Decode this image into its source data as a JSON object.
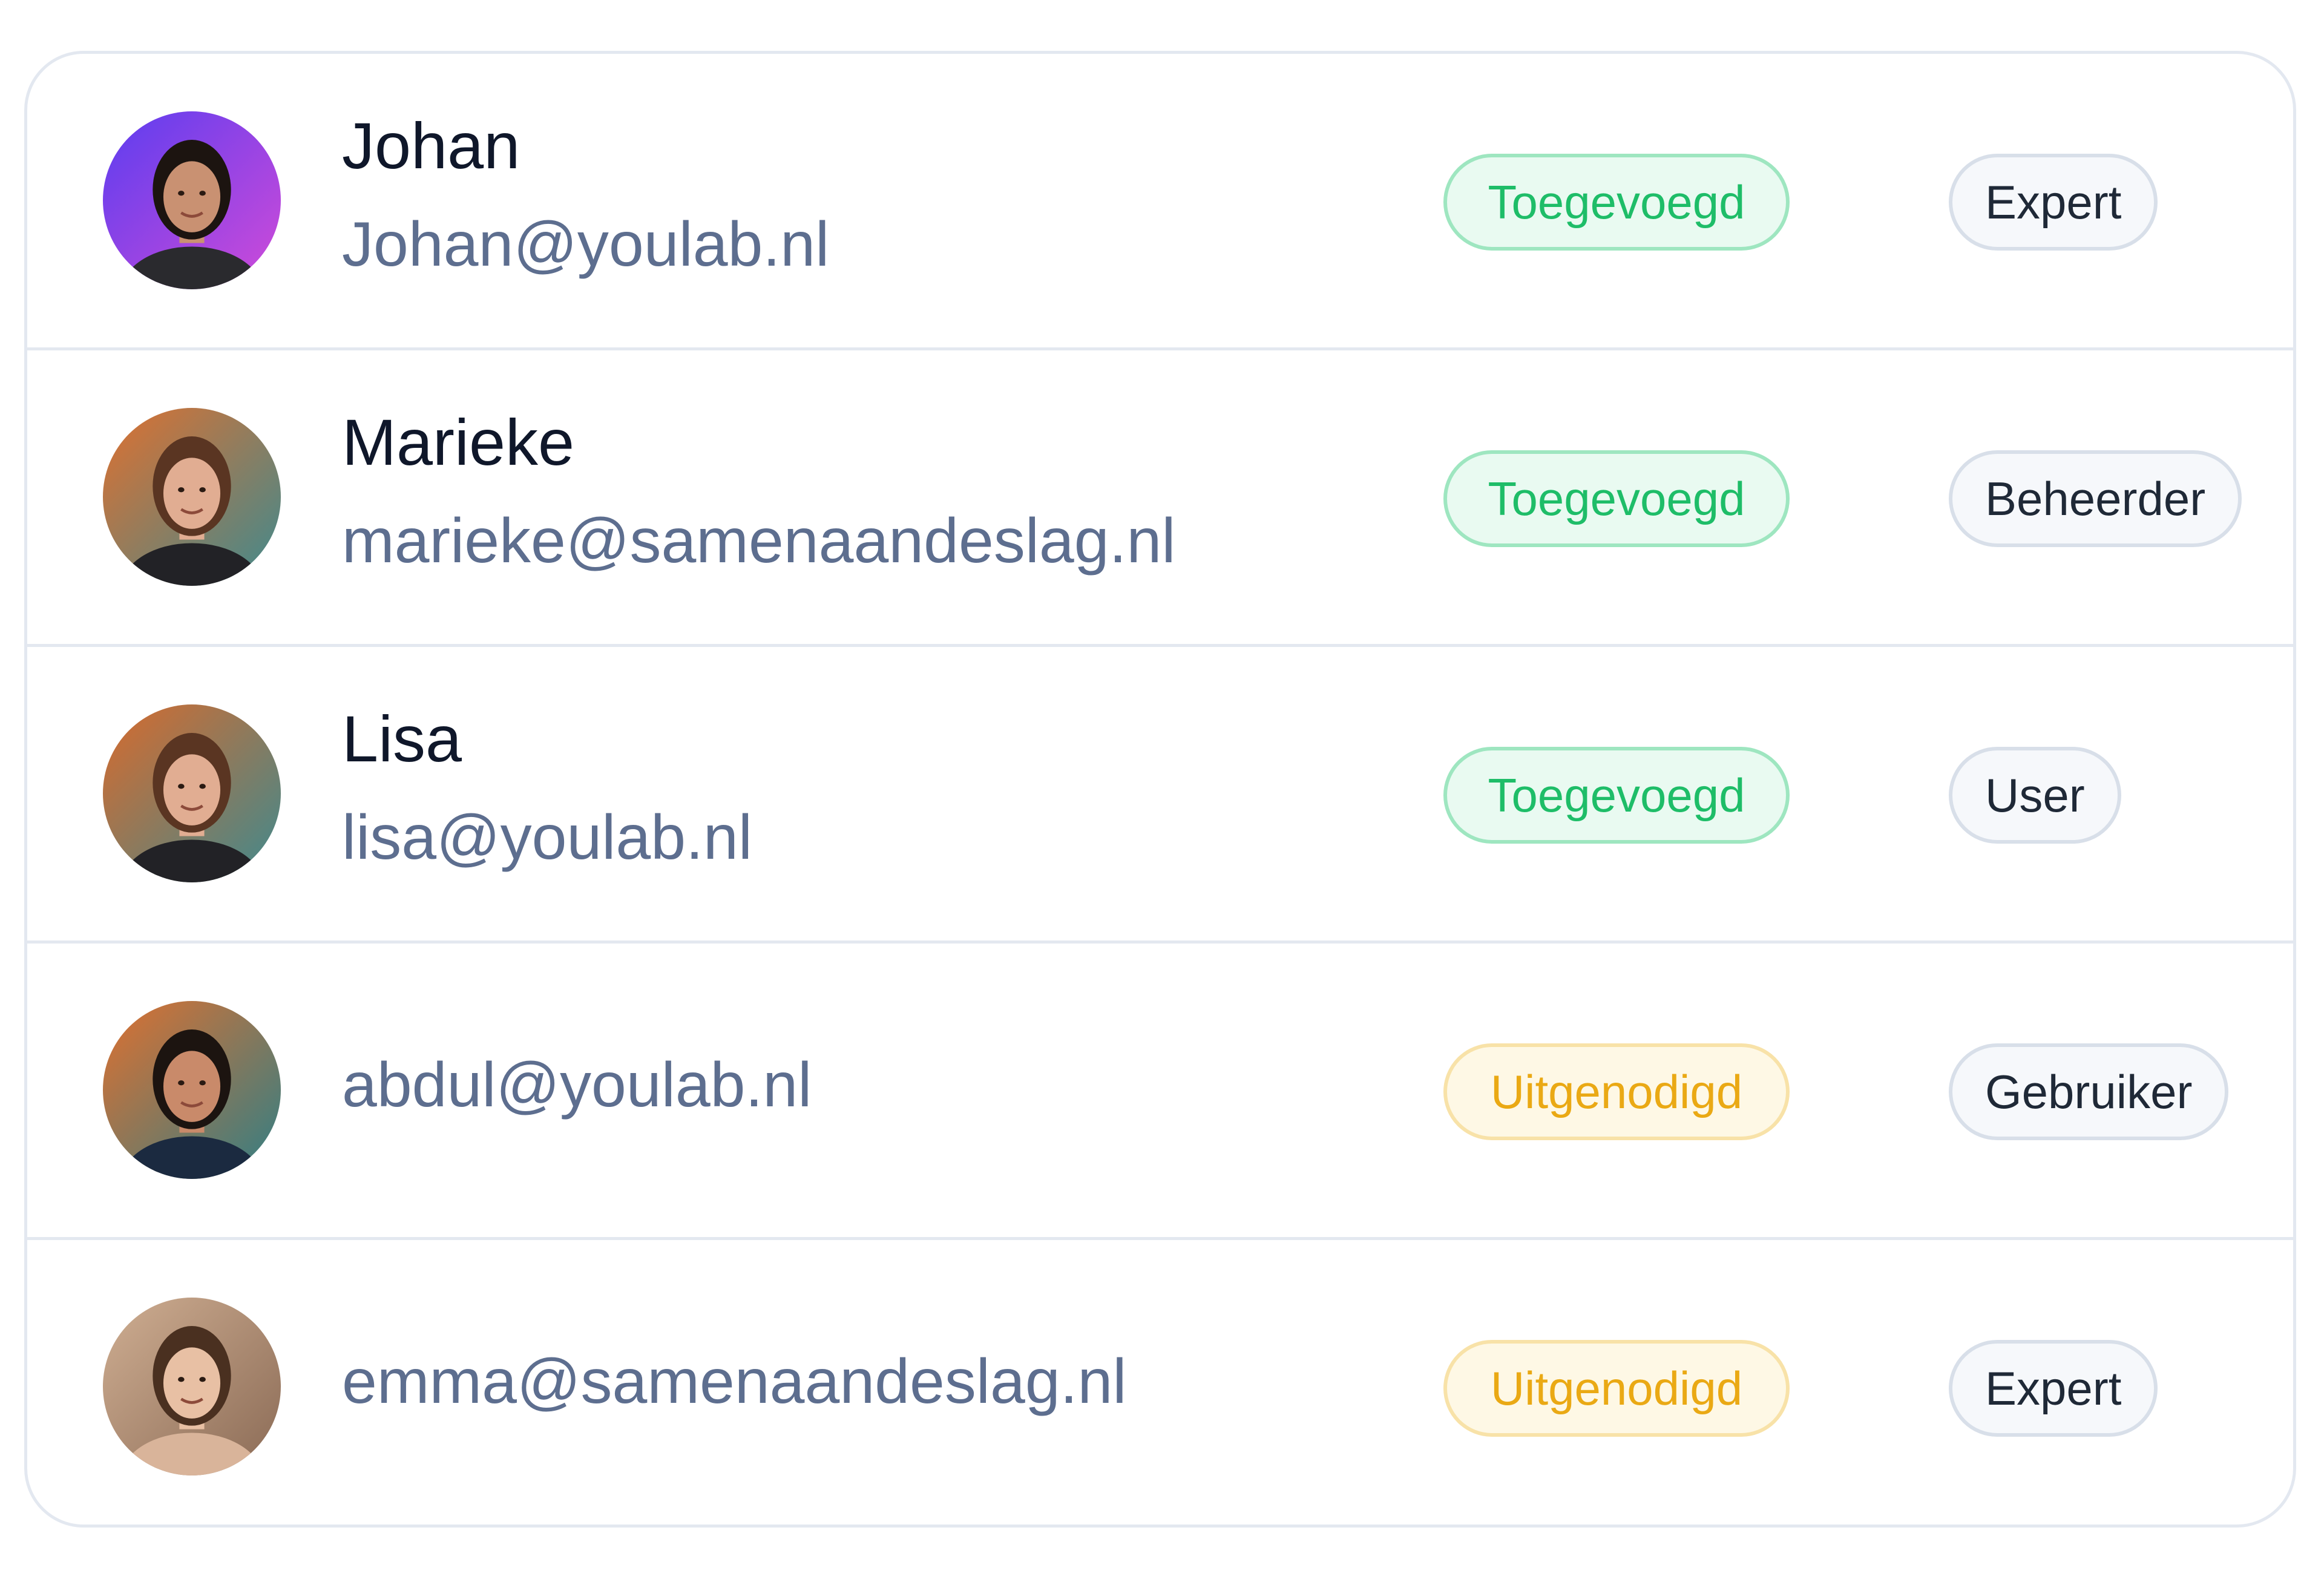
{
  "members": [
    {
      "name": "Johan",
      "email": "Johan@youlab.nl",
      "status": "Toegevoegd",
      "status_type": "added",
      "role": "Expert",
      "avatar": {
        "icon": "avatar-man-purple-bg",
        "bg1": "#5b3df0",
        "bg2": "#d14bd8",
        "hair": "#1c1410",
        "skin": "#c99172",
        "shirt": "#2a2a2e"
      }
    },
    {
      "name": "Marieke",
      "email": "marieke@samenaandeslag.nl",
      "status": "Toegevoegd",
      "status_type": "added",
      "role": "Beheerder",
      "avatar": {
        "icon": "avatar-woman-colorful-bg",
        "bg1": "#e0702f",
        "bg2": "#3e8a8f",
        "hair": "#5a3522",
        "skin": "#e1ad92",
        "shirt": "#222226"
      }
    },
    {
      "name": "Lisa",
      "email": "lisa@youlab.nl",
      "status": "Toegevoegd",
      "status_type": "added",
      "role": "User",
      "avatar": {
        "icon": "avatar-woman-colorful-bg",
        "bg1": "#d96a2c",
        "bg2": "#3e8a8f",
        "hair": "#5a3522",
        "skin": "#e1ad92",
        "shirt": "#222226"
      }
    },
    {
      "name": "",
      "email": "abdul@youlab.nl",
      "status": "Uitgenodigd",
      "status_type": "invited",
      "role": "Gebruiker",
      "avatar": {
        "icon": "avatar-man-colorful-bg",
        "bg1": "#e0702f",
        "bg2": "#2f7f86",
        "hair": "#1c1410",
        "skin": "#c98a6a",
        "shirt": "#1b2a40"
      }
    },
    {
      "name": "",
      "email": "emma@samenaandeslag.nl",
      "status": "Uitgenodigd",
      "status_type": "invited",
      "role": "Expert",
      "avatar": {
        "icon": "avatar-woman-neutral-bg",
        "bg1": "#cfae92",
        "bg2": "#8a6a55",
        "hair": "#4a3020",
        "skin": "#e8c0a4",
        "shirt": "#d9b49a"
      }
    }
  ]
}
